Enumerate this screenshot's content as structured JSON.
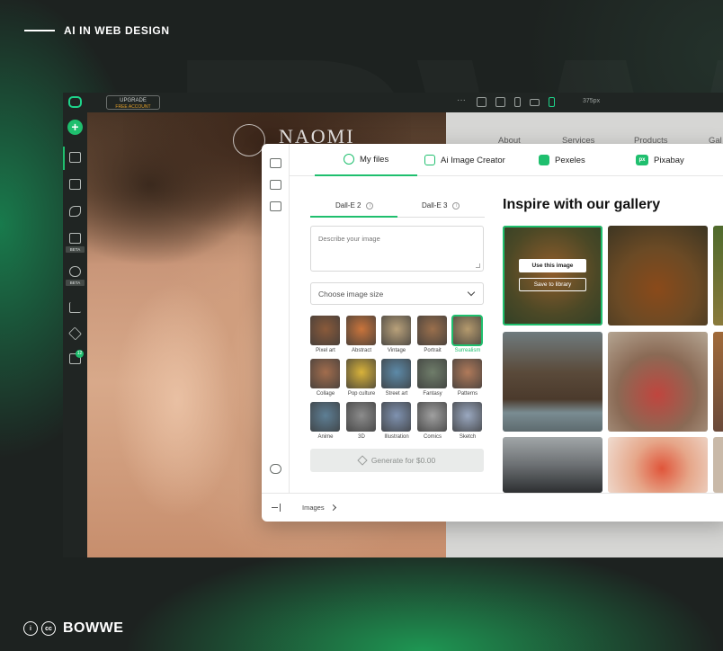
{
  "headline": "AI IN WEB DESIGN",
  "brand": "BOWWE",
  "cc_label": "cc",
  "topbar": {
    "upgrade_title": "UPGRADE",
    "upgrade_sub": "FREE ACCOUNT",
    "width_label": "375px",
    "devices": [
      "more-icon",
      "desktop-icon",
      "laptop-icon",
      "tablet-icon",
      "tablet-landscape-icon",
      "mobile-icon"
    ]
  },
  "sidebar": {
    "badges": [
      "BETA",
      "BETA"
    ],
    "gift_count": "12"
  },
  "site": {
    "logo": "NAOMI",
    "nav": [
      "About",
      "Services",
      "Products",
      "Gal"
    ]
  },
  "modal": {
    "tabs": [
      "My files",
      "Ai Image Creator",
      "Pexeles",
      "Pixabay"
    ],
    "pixabay_icon": "px",
    "sub_tabs": [
      "Dall-E 2",
      "Dall-E 3"
    ],
    "prompt_placeholder": "Describe your image",
    "size_placeholder": "Choose image size",
    "styles": [
      {
        "label": "Pixel art",
        "color": "#8a5a3a"
      },
      {
        "label": "Abstract",
        "color": "#c9743b"
      },
      {
        "label": "Vintage",
        "color": "#b9a17a"
      },
      {
        "label": "Portrait",
        "color": "#9a6f4c"
      },
      {
        "label": "Surrealism",
        "color": "#b59a6d",
        "selected": true
      },
      {
        "label": "Collage",
        "color": "#a26d4d"
      },
      {
        "label": "Pop culture",
        "color": "#d8b23a"
      },
      {
        "label": "Street art",
        "color": "#5d8aa8"
      },
      {
        "label": "Fantasy",
        "color": "#6f7d6a"
      },
      {
        "label": "Patterns",
        "color": "#b07a5a"
      },
      {
        "label": "Anime",
        "color": "#5e7f95"
      },
      {
        "label": "3D",
        "color": "#8c8c8c"
      },
      {
        "label": "Illustration",
        "color": "#7f92b0"
      },
      {
        "label": "Comics",
        "color": "#a0a0a0"
      },
      {
        "label": "Sketch",
        "color": "#9aa8c0"
      }
    ],
    "generate_label": "Generate for $0.00",
    "gallery_title": "Inspire with our gallery",
    "use_image": "Use this image",
    "save_library": "Save to library",
    "breadcrumb": "Images"
  },
  "colors": {
    "accent": "#1fbf6e",
    "dark": "#202523"
  }
}
